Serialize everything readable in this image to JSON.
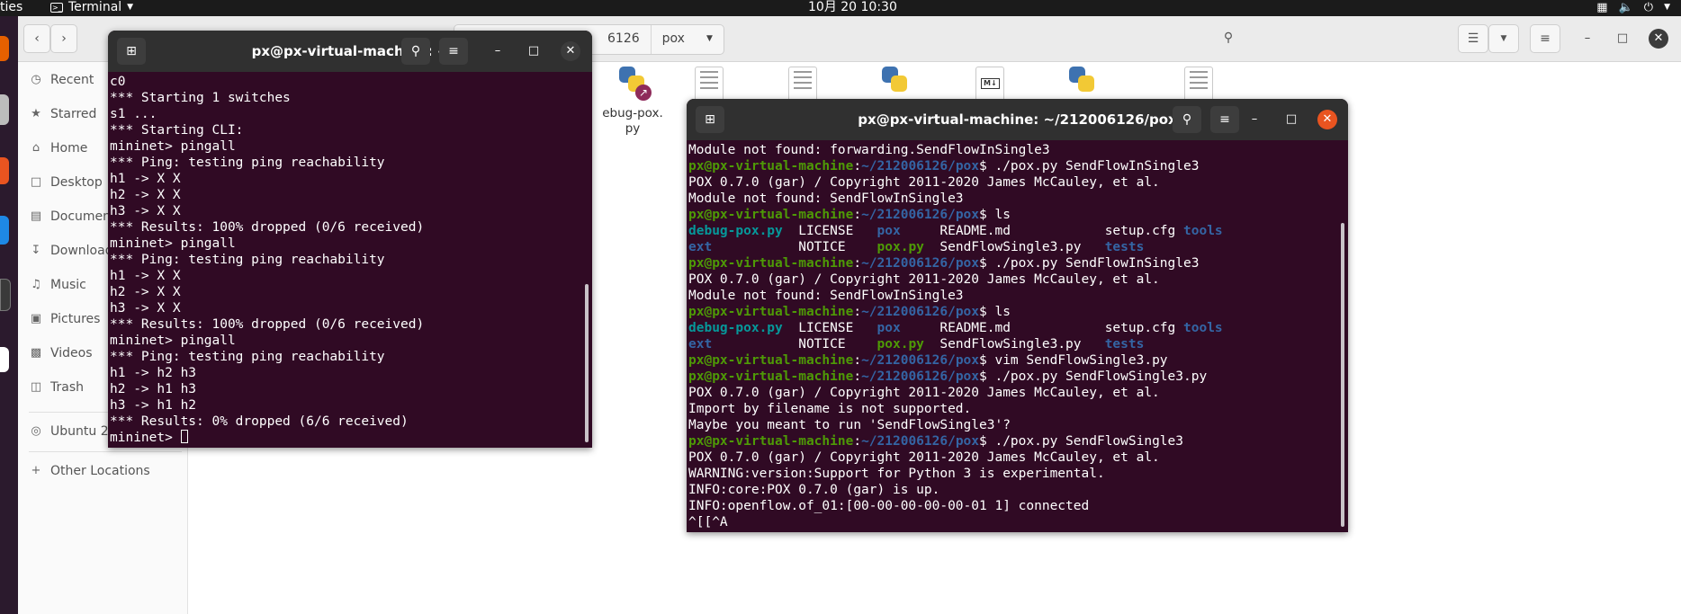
{
  "topbar": {
    "activities": "ties",
    "app_menu": "Terminal",
    "clock": "10月 20  10:30"
  },
  "files": {
    "path": [
      "6126",
      "pox"
    ],
    "sidebar": [
      "Recent",
      "Starred",
      "Home",
      "Desktop",
      "Documents",
      "Downloads",
      "Music",
      "Pictures",
      "Videos",
      "Trash",
      "Ubuntu 2",
      "Other Locations"
    ],
    "visible_file_label": "ebug-pox.\npy"
  },
  "term1": {
    "title": "px@px-virtual-machine: ~",
    "lines": [
      "c0",
      "*** Starting 1 switches",
      "s1 ...",
      "*** Starting CLI:",
      "mininet> pingall",
      "*** Ping: testing ping reachability",
      "h1 -> X X",
      "h2 -> X X",
      "h3 -> X X",
      "*** Results: 100% dropped (0/6 received)",
      "mininet> pingall",
      "*** Ping: testing ping reachability",
      "h1 -> X X",
      "h2 -> X X",
      "h3 -> X X",
      "*** Results: 100% dropped (0/6 received)",
      "mininet> pingall",
      "*** Ping: testing ping reachability",
      "h1 -> h2 h3",
      "h2 -> h1 h3",
      "h3 -> h1 h2",
      "*** Results: 0% dropped (6/6 received)"
    ],
    "prompt": "mininet> "
  },
  "term2": {
    "title": "px@px-virtual-machine: ~/212006126/pox",
    "user": "px@px-virtual-machine",
    "path": "~/212006126/pox",
    "lines": [
      {
        "t": "text",
        "text": "Module not found: forwarding.SendFlowInSingle3"
      },
      {
        "t": "prompt",
        "cmd": "$ ./pox.py SendFlowInSingle3"
      },
      {
        "t": "text",
        "text": "POX 0.7.0 (gar) / Copyright 2011-2020 James McCauley, et al."
      },
      {
        "t": "text",
        "text": "Module not found: SendFlowInSingle3"
      },
      {
        "t": "prompt",
        "cmd": "$ ls"
      },
      {
        "t": "ls",
        "cols": [
          [
            {
              "n": "debug-pox.py",
              "k": "link"
            },
            {
              "n": "LICENSE",
              "k": "file"
            },
            {
              "n": "pox",
              "k": "dir"
            },
            {
              "n": "README.md",
              "k": "file"
            },
            {
              "n": "setup.cfg",
              "k": "file"
            },
            {
              "n": "tools",
              "k": "dir"
            }
          ],
          [
            {
              "n": "ext",
              "k": "dir"
            },
            {
              "n": "NOTICE",
              "k": "file"
            },
            {
              "n": "pox.py",
              "k": "exec"
            },
            {
              "n": "SendFlowSingle3.py",
              "k": "file"
            },
            {
              "n": "tests",
              "k": "dir"
            }
          ]
        ]
      },
      {
        "t": "prompt",
        "cmd": "$ ./pox.py SendFlowInSingle3"
      },
      {
        "t": "text",
        "text": "POX 0.7.0 (gar) / Copyright 2011-2020 James McCauley, et al."
      },
      {
        "t": "text",
        "text": "Module not found: SendFlowInSingle3"
      },
      {
        "t": "prompt",
        "cmd": "$ ls"
      },
      {
        "t": "ls",
        "cols": [
          [
            {
              "n": "debug-pox.py",
              "k": "link"
            },
            {
              "n": "LICENSE",
              "k": "file"
            },
            {
              "n": "pox",
              "k": "dir"
            },
            {
              "n": "README.md",
              "k": "file"
            },
            {
              "n": "setup.cfg",
              "k": "file"
            },
            {
              "n": "tools",
              "k": "dir"
            }
          ],
          [
            {
              "n": "ext",
              "k": "dir"
            },
            {
              "n": "NOTICE",
              "k": "file"
            },
            {
              "n": "pox.py",
              "k": "exec"
            },
            {
              "n": "SendFlowSingle3.py",
              "k": "file"
            },
            {
              "n": "tests",
              "k": "dir"
            }
          ]
        ]
      },
      {
        "t": "prompt",
        "cmd": "$ vim SendFlowSingle3.py"
      },
      {
        "t": "prompt",
        "cmd": "$ ./pox.py SendFlowSingle3.py"
      },
      {
        "t": "text",
        "text": "POX 0.7.0 (gar) / Copyright 2011-2020 James McCauley, et al."
      },
      {
        "t": "text",
        "text": "Import by filename is not supported."
      },
      {
        "t": "text",
        "text": "Maybe you meant to run 'SendFlowSingle3'?"
      },
      {
        "t": "prompt",
        "cmd": "$ ./pox.py SendFlowSingle3"
      },
      {
        "t": "text",
        "text": "POX 0.7.0 (gar) / Copyright 2011-2020 James McCauley, et al."
      },
      {
        "t": "text",
        "text": "WARNING:version:Support for Python 3 is experimental."
      },
      {
        "t": "text",
        "text": "INFO:core:POX 0.7.0 (gar) is up."
      },
      {
        "t": "text",
        "text": "INFO:openflow.of_01:[00-00-00-00-00-01 1] connected"
      },
      {
        "t": "text",
        "text": "^[[^A"
      }
    ]
  },
  "colors": {
    "terminal_bg": "#300a24",
    "prompt_user": "#4e9a06",
    "prompt_path": "#3465a4",
    "close_button": "#e95420"
  }
}
